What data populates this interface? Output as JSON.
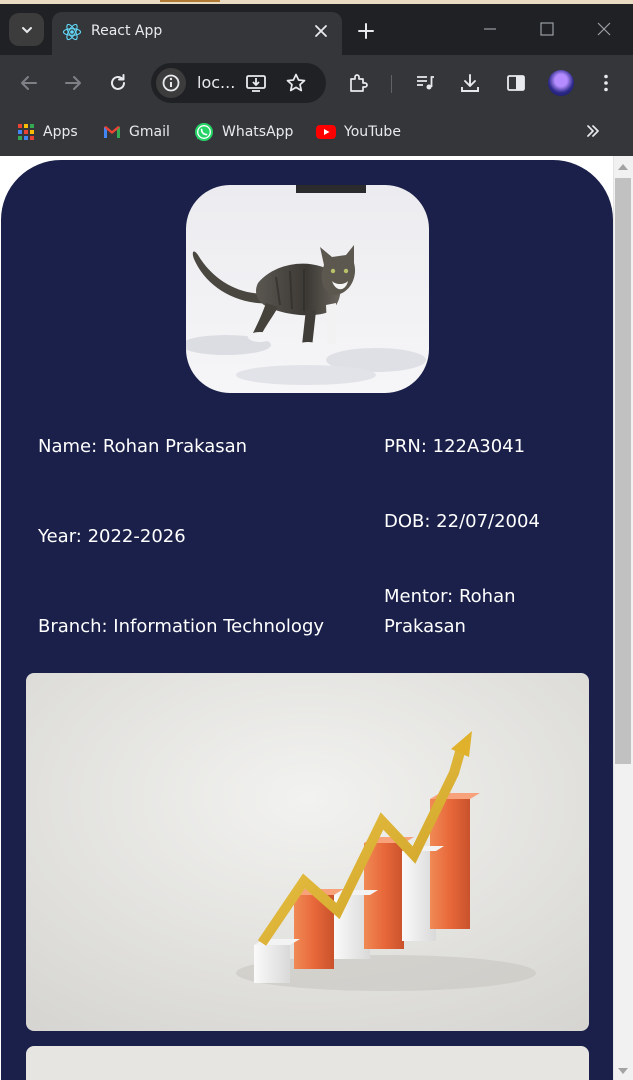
{
  "browser": {
    "tab_title": "React App",
    "address_text": "loc...",
    "bookmarks": [
      {
        "label": "Apps",
        "icon": "apps-grid-icon"
      },
      {
        "label": "Gmail",
        "icon": "gmail-icon"
      },
      {
        "label": "WhatsApp",
        "icon": "whatsapp-icon"
      },
      {
        "label": "YouTube",
        "icon": "youtube-icon"
      }
    ]
  },
  "profile": {
    "name": "Name: Rohan Prakasan",
    "prn": "PRN: 122A3041",
    "year": "Year: 2022-2026",
    "dob": "DOB: 22/07/2004",
    "branch": "Branch: Information Technology",
    "mentor_line1": "Mentor: Rohan",
    "mentor_line2": "Prakasan"
  },
  "colors": {
    "card_background": "#1a2049",
    "browser_frame": "#202124",
    "toolbar": "#35363a"
  }
}
